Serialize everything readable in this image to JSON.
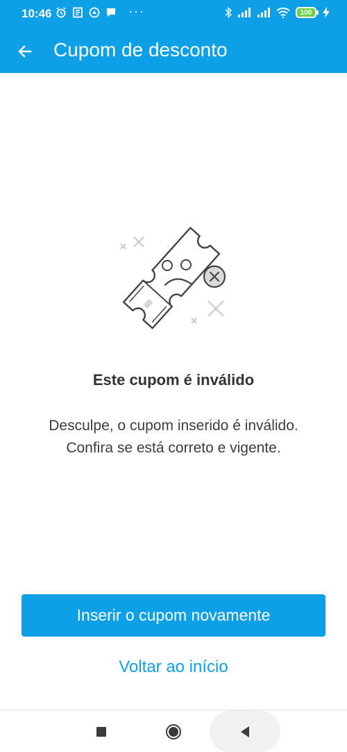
{
  "status_bar": {
    "time": "10:46",
    "dots": "···",
    "battery": "100"
  },
  "app_bar": {
    "title": "Cupom de desconto"
  },
  "content": {
    "heading": "Este cupom é inválido",
    "message_line1": "Desculpe, o cupom inserido é inválido.",
    "message_line2": "Confira se está correto e vigente."
  },
  "actions": {
    "primary_label": "Inserir o cupom novamente",
    "secondary_label": "Voltar ao início"
  },
  "colors": {
    "brand": "#0ea0e6",
    "text_dark": "#333333",
    "battery": "#6ed04b"
  },
  "icons": {
    "back": "arrow-left-icon",
    "illustration": "sad-invalid-coupon-icon",
    "nav_recents": "square-icon",
    "nav_home": "circle-icon",
    "nav_back": "triangle-left-icon"
  }
}
